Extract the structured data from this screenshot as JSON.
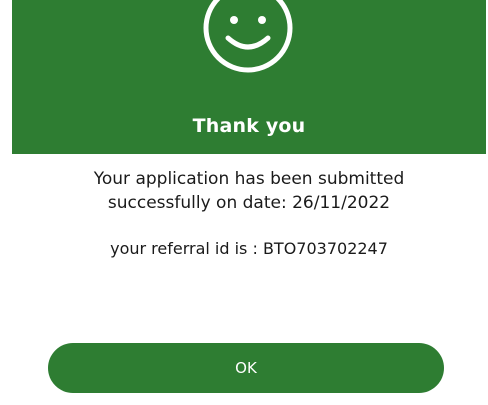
{
  "dialog": {
    "icon": "smiley-face-icon",
    "title": "Thank you",
    "message_line1": "Your application has been submitted",
    "message_line2": "successfully on date: 26/11/2022",
    "referral_text": "your referral id is : BTO703702247",
    "ok_label": "OK"
  },
  "colors": {
    "header_bg": "#2e7d32",
    "button_bg": "#2e7d32",
    "text": "#1a1a1a",
    "on_green": "#ffffff"
  }
}
